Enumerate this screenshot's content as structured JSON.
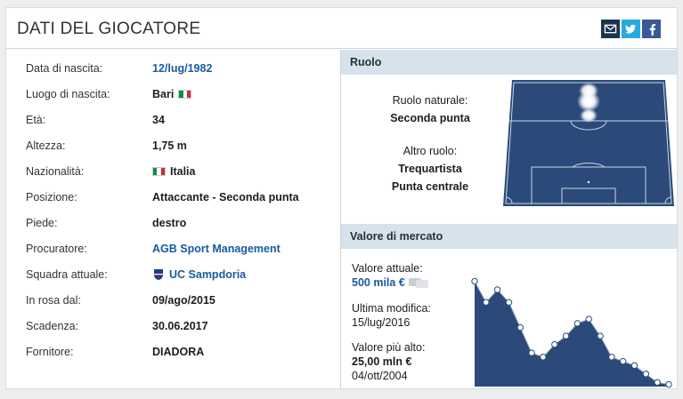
{
  "header": {
    "title": "DATI DEL GIOCATORE"
  },
  "share": {
    "mail_icon": "envelope-icon",
    "twitter_icon": "twitter-icon",
    "facebook_icon": "facebook-icon"
  },
  "player": {
    "rows": [
      {
        "label": "Data di nascita:",
        "value": "12/lug/1982"
      },
      {
        "label": "Luogo di nascita:",
        "value": "Bari"
      },
      {
        "label": "Età:",
        "value": "34"
      },
      {
        "label": "Altezza:",
        "value": "1,75 m"
      },
      {
        "label": "Nazionalità:",
        "value": "Italia"
      },
      {
        "label": "Posizione:",
        "value": "Attaccante - Seconda punta"
      },
      {
        "label": "Piede:",
        "value": "destro"
      },
      {
        "label": "Procuratore:",
        "value": "AGB Sport Management"
      },
      {
        "label": "Squadra attuale:",
        "value": "UC Sampdoria"
      },
      {
        "label": "In rosa dal:",
        "value": "09/ago/2015"
      },
      {
        "label": "Scadenza:",
        "value": "30.06.2017"
      },
      {
        "label": "Fornitore:",
        "value": "DIADORA"
      }
    ]
  },
  "ruolo": {
    "title": "Ruolo",
    "natural_label": "Ruolo naturale:",
    "natural_value": "Seconda punta",
    "other_label": "Altro ruolo:",
    "other_values": [
      "Trequartista",
      "Punta centrale"
    ]
  },
  "mercato": {
    "title": "Valore di mercato",
    "current_label": "Valore attuale:",
    "current_value": "500 mila €",
    "modified_label": "Ultima modifica:",
    "modified_value": "15/lug/2016",
    "highest_label": "Valore più alto:",
    "highest_value": "25,00 mln €",
    "highest_date": "04/ott/2004"
  },
  "colors": {
    "link": "#1a5aa0",
    "section_head": "#d6e2ec",
    "pitch": "#2b4a7a",
    "chart_fill": "#2b4a7a",
    "italy_green": "#009246",
    "italy_red": "#ce2b37"
  },
  "chart_data": {
    "type": "area",
    "series": [
      {
        "values": [
          25.0,
          20.0,
          23.0,
          20.0,
          14.0,
          8.0,
          7.0,
          10.0,
          12.0,
          15.0,
          16.0,
          12.0,
          7.0,
          6.0,
          5.0,
          3.0,
          1.0,
          0.5
        ]
      }
    ],
    "ylim": [
      0,
      27
    ]
  }
}
